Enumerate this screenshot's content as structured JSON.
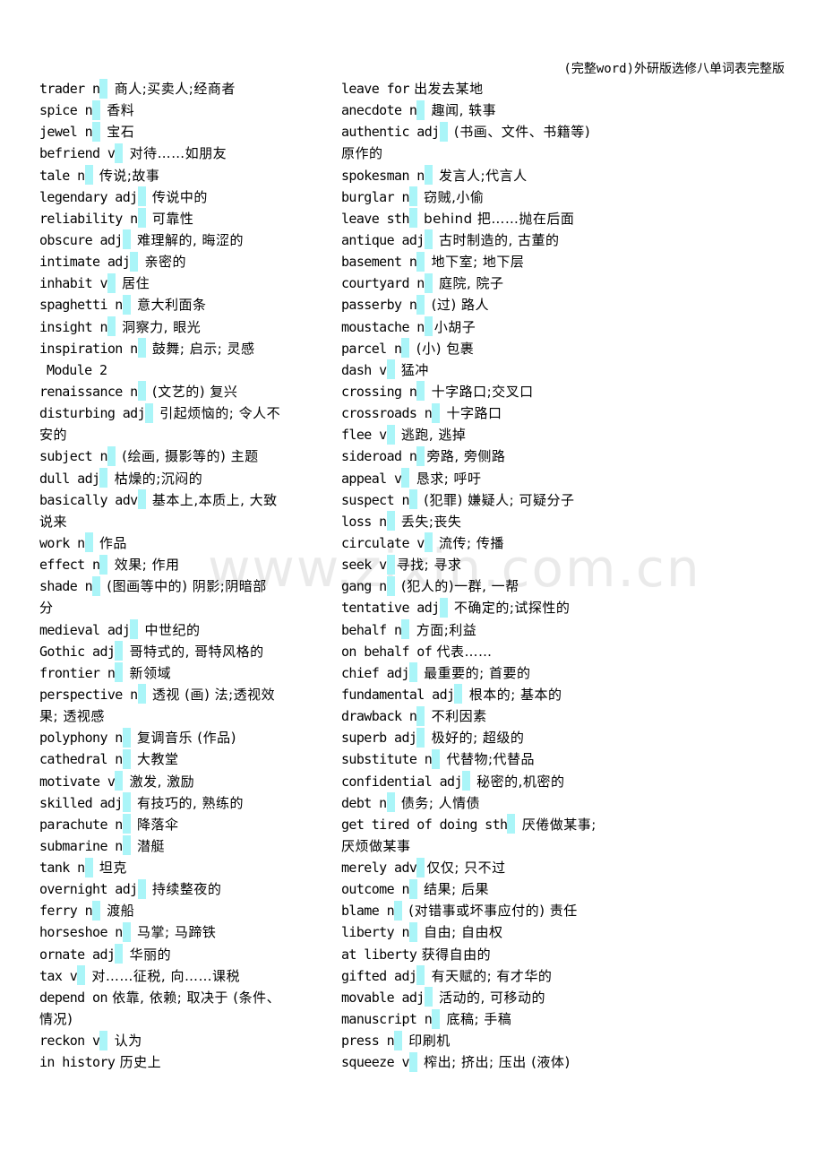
{
  "header": {
    "title": "(完整word)外研版选修八单词表完整版"
  },
  "watermark": "www.zixin.com.cn",
  "highlight_color": "#aaf5f8",
  "left_column": [
    {
      "term": "trader n",
      "hl": true,
      "def": " 商人;买卖人;经商者"
    },
    {
      "term": "spice n",
      "hl": true,
      "def": " 香料"
    },
    {
      "term": "jewel n",
      "hl": true,
      "def": " 宝石"
    },
    {
      "term": "befriend v",
      "hl": true,
      "def": " 对待……如朋友"
    },
    {
      "term": "tale n",
      "hl": true,
      "def": " 传说;故事"
    },
    {
      "term": "legendary adj",
      "hl": true,
      "def": " 传说中的"
    },
    {
      "term": "reliability n",
      "hl": true,
      "def": " 可靠性"
    },
    {
      "term": "obscure adj",
      "hl": true,
      "def": " 难理解的, 晦涩的"
    },
    {
      "term": "intimate adj",
      "hl": true,
      "def": " 亲密的"
    },
    {
      "term": "inhabit v",
      "hl": true,
      "def": " 居住"
    },
    {
      "term": "spaghetti n",
      "hl": true,
      "def": " 意大利面条"
    },
    {
      "term": "insight n",
      "hl": true,
      "def": " 洞察力, 眼光"
    },
    {
      "term": "inspiration n",
      "hl": true,
      "def": " 鼓舞; 启示; 灵感"
    },
    {
      "module": "Module 2"
    },
    {
      "term": "renaissance n",
      "hl": true,
      "def": " (文艺的) 复兴"
    },
    {
      "term": "disturbing adj",
      "hl": true,
      "def": " 引起烦恼的; 令人不"
    },
    {
      "cont": "安的"
    },
    {
      "term": "subject n",
      "hl": true,
      "def": "  (绘画, 摄影等的) 主题"
    },
    {
      "term": "dull adj",
      "hl": true,
      "def": " 枯燥的;沉闷的"
    },
    {
      "term": "basically adv",
      "hl": true,
      "def": " 基本上,本质上, 大致"
    },
    {
      "cont": "说来"
    },
    {
      "term": "work n",
      "hl": true,
      "def": " 作品"
    },
    {
      "term": "effect n",
      "hl": true,
      "def": " 效果; 作用"
    },
    {
      "term": "shade n",
      "hl": true,
      "def": "  (图画等中的) 阴影;阴暗部"
    },
    {
      "cont": "分"
    },
    {
      "term": "medieval adj",
      "hl": true,
      "def": " 中世纪的"
    },
    {
      "term": "Gothic adj",
      "hl": true,
      "def": " 哥特式的, 哥特风格的"
    },
    {
      "term": "frontier n",
      "hl": true,
      "def": " 新领域"
    },
    {
      "term": "perspective n",
      "hl": true,
      "def": " 透视 (画) 法;透视效"
    },
    {
      "cont": "果; 透视感"
    },
    {
      "term": "polyphony n",
      "hl": true,
      "def": " 复调音乐 (作品)"
    },
    {
      "term": "cathedral n",
      "hl": true,
      "def": " 大教堂"
    },
    {
      "term": "motivate v",
      "hl": true,
      "def": " 激发, 激励"
    },
    {
      "term": "skilled adj",
      "hl": true,
      "def": " 有技巧的, 熟练的"
    },
    {
      "term": "parachute n",
      "hl": true,
      "def": " 降落伞"
    },
    {
      "term": "submarine n",
      "hl": true,
      "def": " 潜艇"
    },
    {
      "term": "tank n",
      "hl": true,
      "def": " 坦克"
    },
    {
      "term": "overnight adj",
      "hl": true,
      "def": " 持续整夜的"
    },
    {
      "term": "ferry n",
      "hl": true,
      "def": " 渡船"
    },
    {
      "term": "horseshoe n",
      "hl": true,
      "def": " 马掌; 马蹄铁"
    },
    {
      "term": "ornate adj",
      "hl": true,
      "def": " 华丽的"
    },
    {
      "term": "tax v",
      "hl": true,
      "def": " 对……征税, 向……课税"
    },
    {
      "term": "depend on",
      "hl": false,
      "def": " 依靠, 依赖; 取决于 (条件、"
    },
    {
      "cont": "情况)"
    },
    {
      "term": "reckon v",
      "hl": true,
      "def": " 认为"
    },
    {
      "term": "in history",
      "hl": false,
      "def": " 历史上"
    }
  ],
  "right_column": [
    {
      "term": "leave for",
      "hl": false,
      "def": " 出发去某地"
    },
    {
      "term": "anecdote n",
      "hl": true,
      "def": " 趣闻, 轶事"
    },
    {
      "term": "authentic adj",
      "hl": true,
      "def": " (书画、文件、书籍等)"
    },
    {
      "cont": "原作的"
    },
    {
      "term": "spokesman n",
      "hl": true,
      "def": " 发言人;代言人"
    },
    {
      "term": "burglar n",
      "hl": true,
      "def": " 窃贼,小偷"
    },
    {
      "term": "leave sth",
      "hl": true,
      "def": " behind 把……抛在后面"
    },
    {
      "term": "antique adj",
      "hl": true,
      "def": " 古时制造的, 古董的"
    },
    {
      "term": "basement n",
      "hl": true,
      "def": " 地下室; 地下层"
    },
    {
      "term": "courtyard n",
      "hl": true,
      "def": " 庭院, 院子"
    },
    {
      "term": "passerby n",
      "hl": true,
      "def": "  (过) 路人"
    },
    {
      "term": "moustache n",
      "hl": true,
      "def": "小胡子"
    },
    {
      "term": "parcel n",
      "hl": true,
      "def": " (小) 包裹"
    },
    {
      "term": "dash v",
      "hl": true,
      "def": " 猛冲"
    },
    {
      "term": "crossing n",
      "hl": true,
      "def": " 十字路口;交叉口"
    },
    {
      "term": "crossroads n",
      "hl": true,
      "def": " 十字路口"
    },
    {
      "term": "flee v",
      "hl": true,
      "def": " 逃跑, 逃掉"
    },
    {
      "term": "sideroad n",
      "hl": true,
      "def": "旁路, 旁侧路"
    },
    {
      "term": "appeal v",
      "hl": true,
      "def": " 恳求; 呼吁"
    },
    {
      "term": "suspect n",
      "hl": true,
      "def": "  (犯罪) 嫌疑人; 可疑分子"
    },
    {
      "term": "loss n",
      "hl": true,
      "def": " 丢失;丧失"
    },
    {
      "term": "circulate v",
      "hl": true,
      "def": " 流传; 传播"
    },
    {
      "term": "seek v",
      "hl": true,
      "def": "寻找; 寻求"
    },
    {
      "term": "gang n",
      "hl": true,
      "def": "  (犯人的)一群, 一帮"
    },
    {
      "term": "tentative adj",
      "hl": true,
      "def": " 不确定的;试探性的"
    },
    {
      "term": "behalf n",
      "hl": true,
      "def": " 方面;利益"
    },
    {
      "term": "on behalf of",
      "hl": false,
      "def": " 代表……"
    },
    {
      "term": "chief adj",
      "hl": true,
      "def": " 最重要的; 首要的"
    },
    {
      "term": "fundamental adj",
      "hl": true,
      "def": " 根本的; 基本的"
    },
    {
      "term": "drawback n",
      "hl": true,
      "def": " 不利因素"
    },
    {
      "term": "superb adj",
      "hl": true,
      "def": " 极好的; 超级的"
    },
    {
      "term": "substitute n",
      "hl": true,
      "def": " 代替物;代替品"
    },
    {
      "term": "confidential adj",
      "hl": true,
      "def": " 秘密的,机密的"
    },
    {
      "term": "debt n",
      "hl": true,
      "def": " 债务; 人情债"
    },
    {
      "term": "get tired of doing sth",
      "hl": true,
      "def": " 厌倦做某事;"
    },
    {
      "cont": "厌烦做某事"
    },
    {
      "term": "merely adv",
      "hl": true,
      "def": "仅仅; 只不过"
    },
    {
      "term": "outcome n",
      "hl": true,
      "def": " 结果; 后果"
    },
    {
      "term": "blame n",
      "hl": true,
      "def": "  (对错事或坏事应付的) 责任"
    },
    {
      "term": "liberty n",
      "hl": true,
      "def": " 自由; 自由权"
    },
    {
      "term": "at liberty",
      "hl": false,
      "def": " 获得自由的"
    },
    {
      "term": "gifted adj",
      "hl": true,
      "def": " 有天赋的; 有才华的"
    },
    {
      "term": "movable adj",
      "hl": true,
      "def": " 活动的, 可移动的"
    },
    {
      "term": "manuscript n",
      "hl": true,
      "def": " 底稿; 手稿"
    },
    {
      "term": "press n",
      "hl": true,
      "def": " 印刷机"
    },
    {
      "term": "squeeze v",
      "hl": true,
      "def": " 榨出; 挤出; 压出 (液体)"
    }
  ]
}
